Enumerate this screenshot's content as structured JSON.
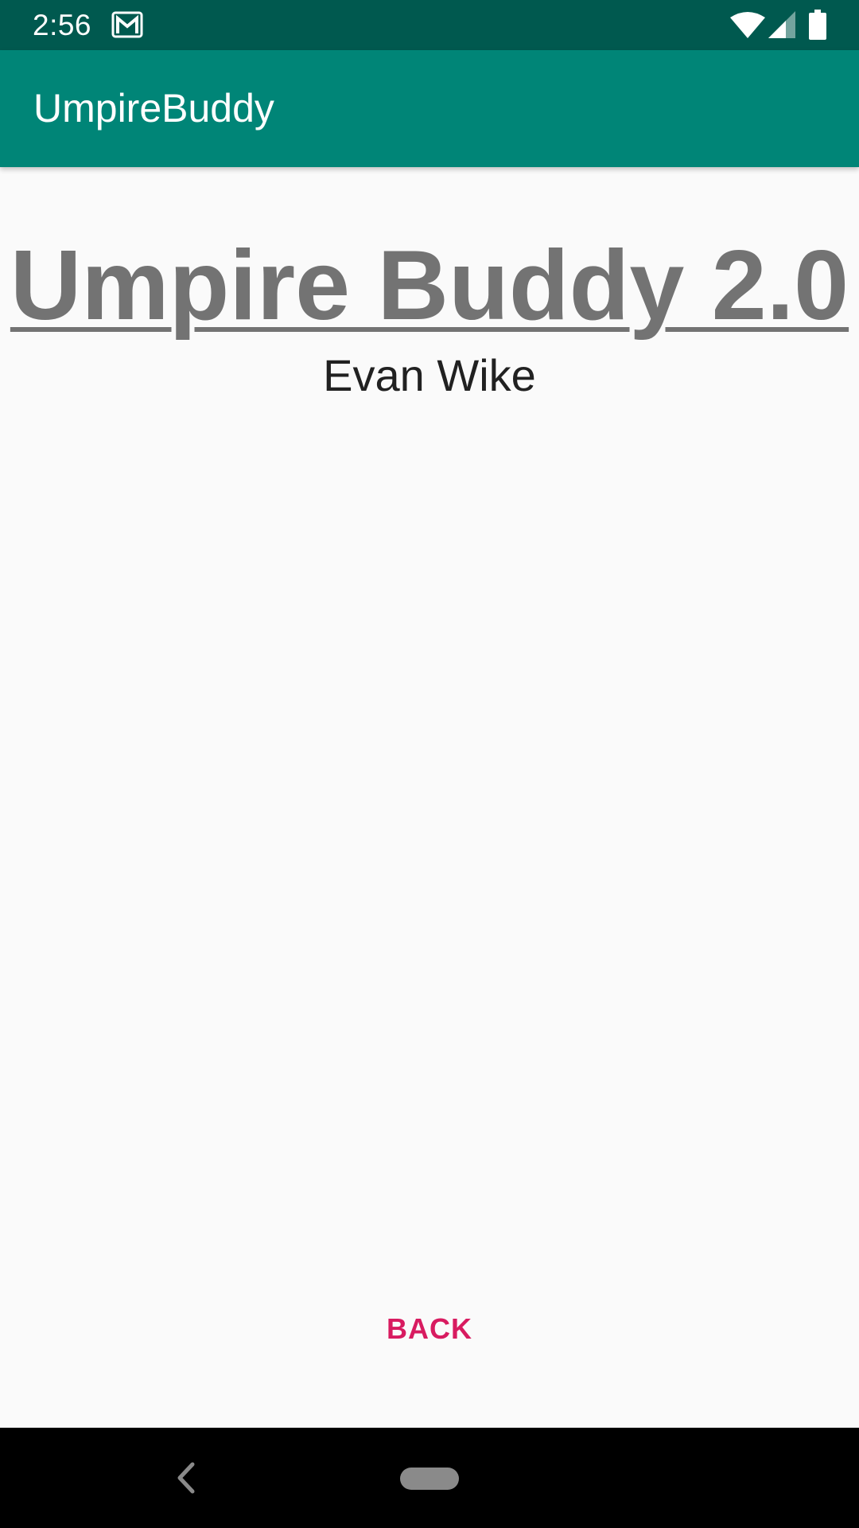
{
  "status_bar": {
    "time": "2:56",
    "icons": [
      "gmail-icon",
      "wifi-icon",
      "signal-icon",
      "battery-icon"
    ]
  },
  "app_bar": {
    "title": "UmpireBuddy"
  },
  "main": {
    "title": "Umpire Buddy 2.0",
    "author": "Evan Wike",
    "back_label": "BACK"
  },
  "nav_bar": {
    "icons": [
      "back-nav-icon",
      "home-pill-icon"
    ]
  },
  "colors": {
    "status_bar": "#00594f",
    "app_bar": "#008577",
    "accent": "#d81b60",
    "title_text": "#737373",
    "background": "#fafafa"
  }
}
